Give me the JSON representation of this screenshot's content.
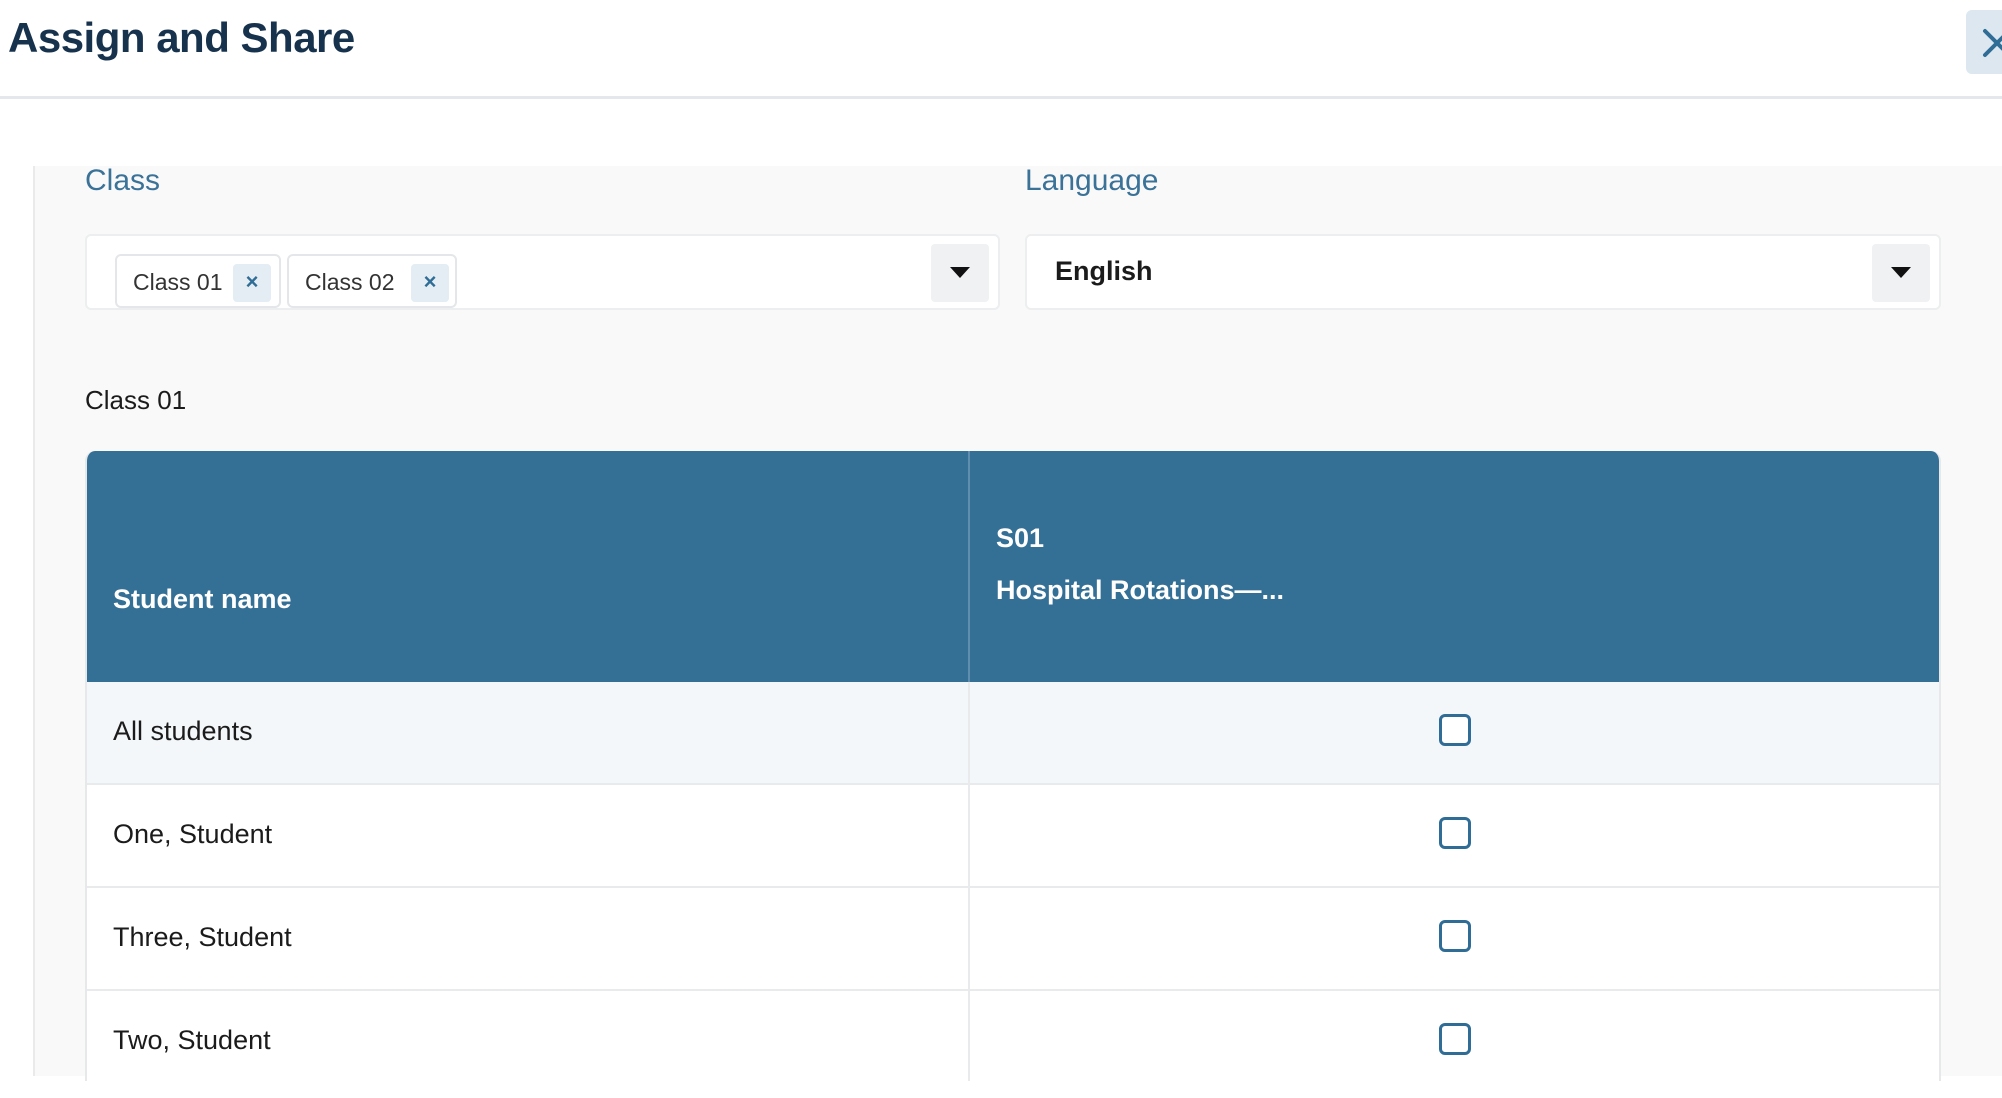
{
  "header": {
    "title": "Assign and Share",
    "close_icon": "close-icon"
  },
  "form": {
    "class_label": "Class",
    "class_chips": [
      {
        "label": "Class 01",
        "remove": "×"
      },
      {
        "label": "Class 02",
        "remove": "×"
      }
    ],
    "language_label": "Language",
    "language_value": "English"
  },
  "section": {
    "label": "Class 01"
  },
  "table": {
    "col_name": "Student name",
    "col_assignment_code": "S01",
    "col_assignment_title": "Hospital Rotations—...",
    "rows": [
      {
        "name": "All students",
        "checked": false
      },
      {
        "name": "One, Student",
        "checked": false
      },
      {
        "name": "Three, Student",
        "checked": false
      },
      {
        "name": "Two, Student",
        "checked": false
      }
    ]
  },
  "colors": {
    "accent": "#347096",
    "title": "#17324d",
    "label": "#3a7298"
  }
}
